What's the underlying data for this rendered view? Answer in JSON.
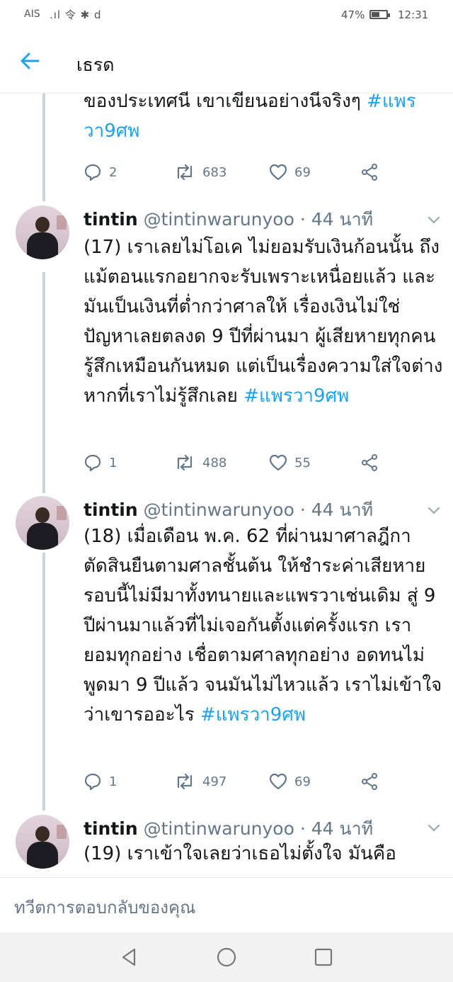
{
  "status": {
    "carrier": "AIS",
    "signal": ".ıl 令 ✱ d",
    "battery": "47%",
    "time": "12:31"
  },
  "header": {
    "title": "เธรด"
  },
  "top_tweet": {
    "text": "ของประเทศนี เขาเขียนอย่างนีจริงๆ ",
    "hashtag": "#แพรวา9ศพ",
    "replies": "2",
    "retweets": "683",
    "likes": "69"
  },
  "tweets": [
    {
      "name": "tintin",
      "handle": "@tintinwarunyoo · 44 นาที",
      "text": "(17) เราเลยไม่โอเค ไม่ยอมรับเงินก้อนนั้น ถึงแม้ตอนแรกอยากจะรับเพราะเหนื่อยแล้ว และมันเป็นเงินที่ต่ำกว่าศาลให้ เรื่องเงินไม่ใช่ปัญหาเลยตลงด 9 ปีที่ผ่านมา ผู้เสียหายทุกคนรู้สึกเหมือนกันหมด แต่เป็นเรื่องความใส่ใจต่างหากที่เราไม่รู้สึกเลย ",
      "hashtag": "#แพรวา9ศพ",
      "replies": "1",
      "retweets": "488",
      "likes": "55"
    },
    {
      "name": "tintin",
      "handle": "@tintinwarunyoo · 44 นาที",
      "text": "(18) เมื่อเดือน พ.ค. 62 ที่ผ่านมาศาลฎีกาตัดสินยืนตามศาลชั้นต้น ให้ชำระค่าเสียหาย รอบนี้ไม่มีมาทั้งทนายและแพรวาเช่นเดิม สู่ 9 ปีผ่านมาแล้วที่ไม่เจอกันตั้งแต่ครั้งแรก เรายอมทุกอย่าง เชื่อตามศาลทุกอย่าง อดทนไม่พูดมา 9 ปีแล้ว จนมันไม่ไหวแล้ว เราไม่เข้าใจว่าเขารออะไร  ",
      "hashtag": "#แพรวา9ศพ",
      "replies": "1",
      "retweets": "497",
      "likes": "69"
    },
    {
      "name": "tintin",
      "handle": "@tintinwarunyoo · 44 นาที",
      "text": "(19) เราเข้าใจเลยว่าเธอไม่ตั้งใจ มันคือ"
    }
  ],
  "reply_placeholder": "ทวีตการตอบกลับของคุณ",
  "nav": [
    "back",
    "home",
    "recents"
  ]
}
